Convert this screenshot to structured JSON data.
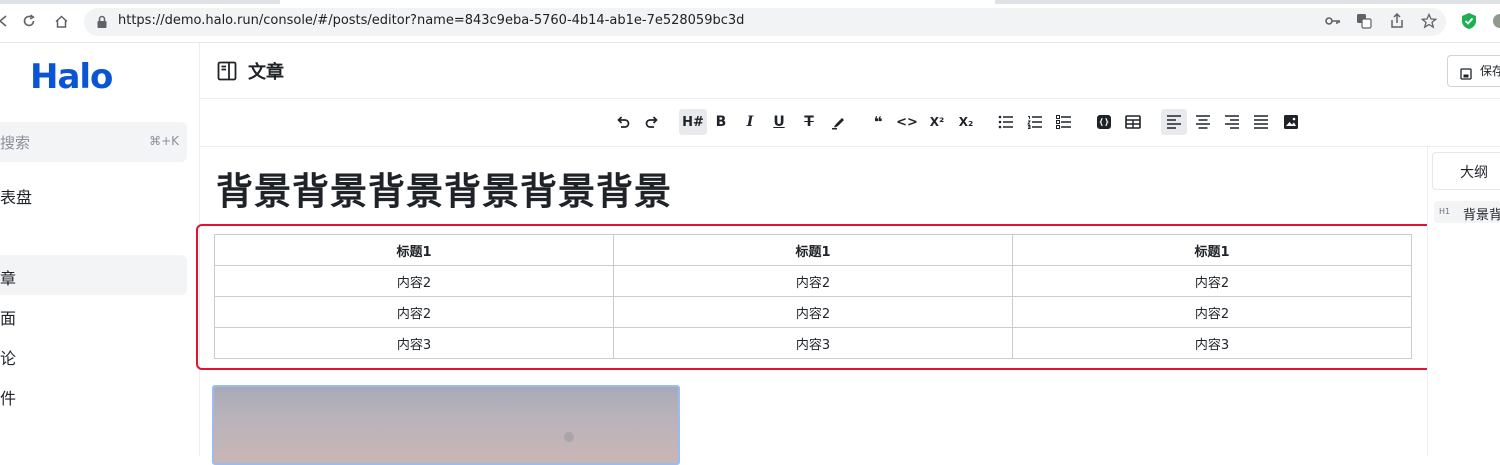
{
  "browser": {
    "url": "https://demo.halo.run/console/#/posts/editor?name=843c9eba-5760-4b14-ab1e-7e528059bc3d",
    "icons": [
      "back-icon",
      "forward-icon",
      "reload-icon",
      "home-icon",
      "lock-icon",
      "key-icon",
      "translate-icon",
      "share-icon",
      "bookmark-star-icon",
      "extension-shield-icon",
      "profile-avatar-icon"
    ]
  },
  "sidebar": {
    "logo": "Halo",
    "search": {
      "placeholder": "搜索",
      "shortcut": "⌘+K"
    },
    "items": [
      {
        "label": "仪表盘",
        "active": false
      },
      {
        "label": "文章",
        "active": true
      },
      {
        "label": "页面",
        "active": false
      },
      {
        "label": "评论",
        "active": false
      },
      {
        "label": "附件",
        "active": false
      }
    ]
  },
  "header": {
    "title": "文章",
    "save_label": "保存"
  },
  "toolbar": {
    "heading_label": "H#",
    "bold_label": "B",
    "italic_label": "I",
    "underline_label": "U",
    "strike_label": "T",
    "quote_label": "❝",
    "code_label": "<>",
    "superscript_label": "X²",
    "subscript_label": "X₂",
    "active": [
      "heading",
      "align-left"
    ]
  },
  "editor": {
    "title": "背景背景背景背景背景背景",
    "table": {
      "headers": [
        "标题1",
        "标题1",
        "标题1"
      ],
      "rows": [
        [
          "内容2",
          "内容2",
          "内容2"
        ],
        [
          "内容2",
          "内容2",
          "内容2"
        ],
        [
          "内容3",
          "内容3",
          "内容3"
        ]
      ]
    },
    "highlight_color": "#e3122e"
  },
  "outline": {
    "tab_label": "大纲",
    "items": [
      {
        "level": "H1",
        "text": "背景背"
      }
    ]
  },
  "colors": {
    "brand": "#0a55d6",
    "highlight": "#e3122e"
  }
}
